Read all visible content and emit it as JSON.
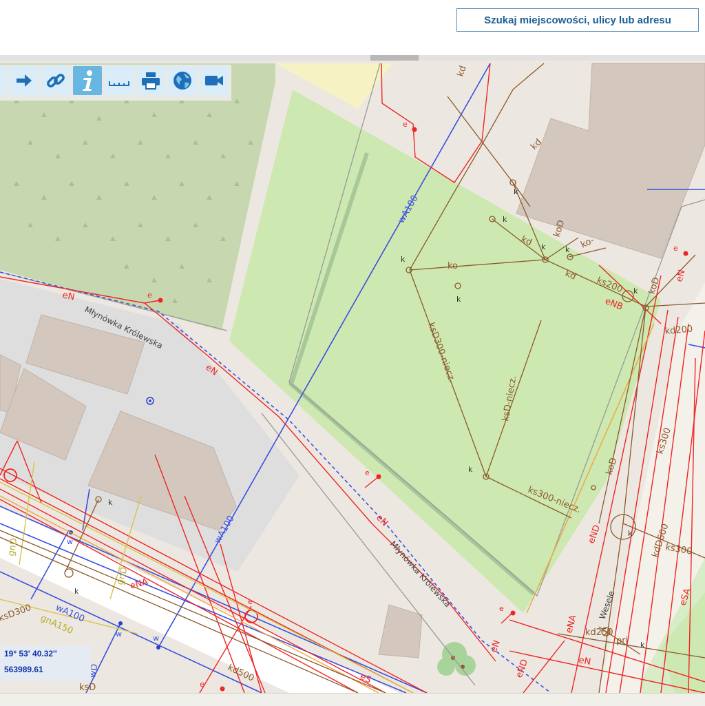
{
  "search": {
    "label": "Szukaj miejscowości, ulicy lub adresu"
  },
  "toolbar": {
    "tools": [
      {
        "name": "arrow-right"
      },
      {
        "name": "link"
      },
      {
        "name": "info",
        "active": true
      },
      {
        "name": "ruler"
      },
      {
        "name": "printer"
      },
      {
        "name": "globe"
      },
      {
        "name": "video-camera"
      }
    ]
  },
  "coordinates": {
    "lon": "19° 53' 40.32''",
    "y": "563989.61"
  },
  "map": {
    "street_labels": {
      "mlynowka_1": "Młynówka Królewska",
      "mlynowka_2": "Młynówka Królewska",
      "wesele": "Wesele"
    },
    "utility_labels": {
      "wa100_a": "wA100",
      "wa100_b": "wA100",
      "wa100_c": "wA100",
      "en_1": "eN",
      "en_2": "eN",
      "en_3": "eN",
      "en_4": "eN",
      "en_5": "eN",
      "en_6": "eN",
      "enb": "eNB",
      "ena_1": "eNA",
      "ena_2": "eNA",
      "end_1": "eND",
      "end_2": "eND",
      "esa": "eSA",
      "es": "eS",
      "ksd300_niecz": "ksD300-niecz.",
      "ksd_niecz": "ksD-niecz.",
      "ks300_niecz": "ks300-niecz.",
      "ks200": "ks200",
      "ks300": "ks300",
      "ks300b": "ks300",
      "kd200": "kd200",
      "kd_1": "kd",
      "kd_2": "kd",
      "kd_3": "kd",
      "kd_4": "kd",
      "kod_1": "koD",
      "kod_2": "koD",
      "kod_3": "koD",
      "ko_1": "ko",
      "ko_2": "ko-",
      "kdd600": "kdD600",
      "kd500": "kd500",
      "kd250": "kd250",
      "kd_prj": "prj",
      "ksd300_left": "ksD300",
      "ksd_left": "ksD",
      "gnd_1": "gnD",
      "gnd_2": "gnD",
      "gna150": "gnA150",
      "wd": "wD",
      "k": "k",
      "e": "e",
      "w": "w"
    }
  },
  "colors": {
    "park": "#cde8b0",
    "forest": "#c7d8b1",
    "building": "#d4c8be",
    "residential": "#dedede",
    "water_line": "#3b4fe0",
    "power_line": "#ef2424",
    "sewer_line": "#8b5a2b",
    "gas_line": "#c8bf46",
    "coords_text": "#1032a8",
    "search_text": "#1d5f93"
  }
}
